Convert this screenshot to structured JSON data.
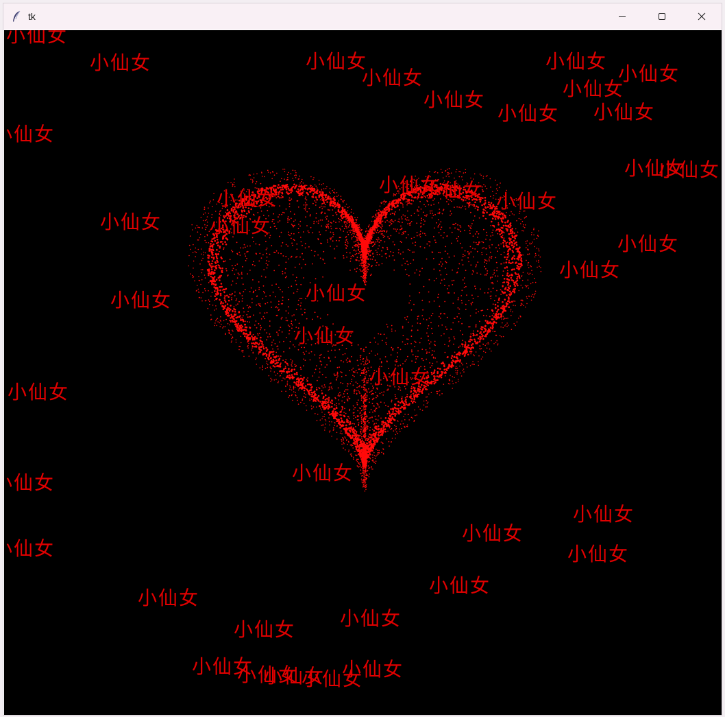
{
  "window": {
    "title": "tk",
    "minimize_label": "Minimize",
    "maximize_label": "Maximize",
    "close_label": "Close"
  },
  "canvas": {
    "background": "#000000",
    "accent": "#ff0000",
    "floating_text": "小仙女",
    "heart_color": "#ff0a0a"
  }
}
